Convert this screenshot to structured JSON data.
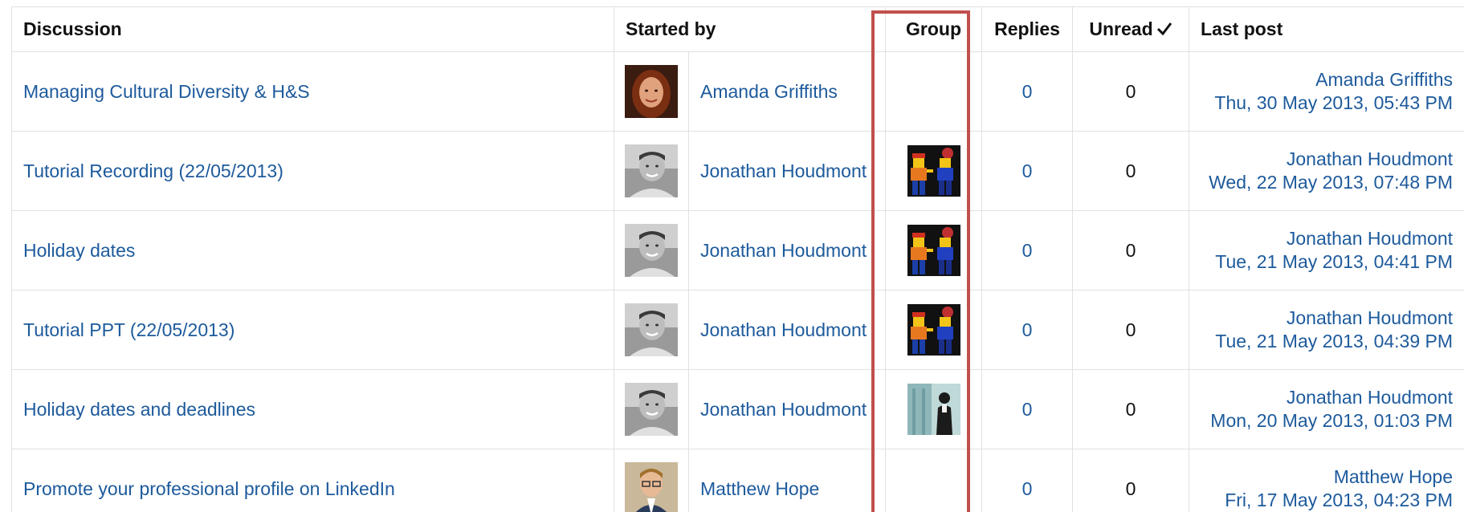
{
  "headers": {
    "discussion": "Discussion",
    "started_by": "Started by",
    "group": "Group",
    "replies": "Replies",
    "unread": "Unread",
    "last_post": "Last post"
  },
  "icons": {
    "unread_check": "checkmark-icon",
    "avatar_female": "avatar-photo-woman",
    "avatar_male": "avatar-photo-man",
    "avatar_male_2": "avatar-photo-man-glasses",
    "group_lego": "group-picture-lego-figures",
    "group_office": "group-picture-office-worker"
  },
  "colors": {
    "link": "#1d5a9c",
    "highlight_border": "#c0504d",
    "grid": "#e1e1e1"
  },
  "rows": [
    {
      "discussion": "Managing Cultural Diversity & H&S",
      "author": "Amanda Griffiths",
      "avatar": "female",
      "group": "none",
      "replies": "0",
      "unread": "0",
      "last_author": "Amanda Griffiths",
      "last_date": "Thu, 30 May 2013, 05:43 PM"
    },
    {
      "discussion": "Tutorial Recording (22/05/2013)",
      "author": "Jonathan Houdmont",
      "avatar": "male",
      "group": "lego",
      "replies": "0",
      "unread": "0",
      "last_author": "Jonathan Houdmont",
      "last_date": "Wed, 22 May 2013, 07:48 PM"
    },
    {
      "discussion": "Holiday dates",
      "author": "Jonathan Houdmont",
      "avatar": "male",
      "group": "lego",
      "replies": "0",
      "unread": "0",
      "last_author": "Jonathan Houdmont",
      "last_date": "Tue, 21 May 2013, 04:41 PM"
    },
    {
      "discussion": "Tutorial PPT (22/05/2013)",
      "author": "Jonathan Houdmont",
      "avatar": "male",
      "group": "lego",
      "replies": "0",
      "unread": "0",
      "last_author": "Jonathan Houdmont",
      "last_date": "Tue, 21 May 2013, 04:39 PM"
    },
    {
      "discussion": "Holiday dates and deadlines",
      "author": "Jonathan Houdmont",
      "avatar": "male",
      "group": "office",
      "replies": "0",
      "unread": "0",
      "last_author": "Jonathan Houdmont",
      "last_date": "Mon, 20 May 2013, 01:03 PM"
    },
    {
      "discussion": "Promote your professional profile on LinkedIn",
      "author": "Matthew Hope",
      "avatar": "male2",
      "group": "none",
      "replies": "0",
      "unread": "0",
      "last_author": "Matthew Hope",
      "last_date": "Fri, 17 May 2013, 04:23 PM"
    }
  ]
}
